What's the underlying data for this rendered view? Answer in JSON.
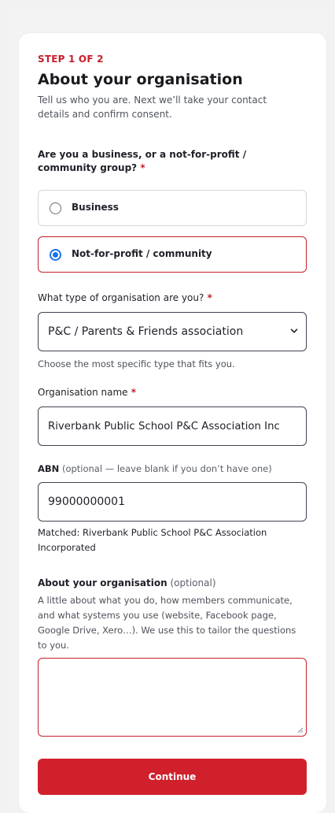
{
  "header": {
    "step": "STEP 1 OF 2",
    "title": "About your organisation",
    "intro": "Tell us who you are. Next we’ll take your contact details and confirm consent."
  },
  "org_kind": {
    "question": "Are you a business, or a not-for-profit / community group?",
    "required_mark": "*",
    "options": [
      {
        "label": "Business",
        "selected": false
      },
      {
        "label": "Not-for-profit / community",
        "selected": true
      }
    ]
  },
  "org_type": {
    "label": "What type of organisation are you?",
    "required_mark": "*",
    "value": "P&C / Parents & Friends association",
    "help": "Choose the most specific type that fits you."
  },
  "org_name": {
    "label": "Organisation name",
    "required_mark": "*",
    "value": "Riverbank Public School P&C Association Inc"
  },
  "abn": {
    "label": "ABN",
    "optional_note": "(optional — leave blank if you don’t have one)",
    "value": "99000000001",
    "match": "Matched: Riverbank Public School P&C Association Incorporated"
  },
  "about": {
    "label": "About your organisation",
    "optional_note": "(optional)",
    "help": "A little about what you do, how members communicate, and what systems you use (website, Facebook page, Google Drive, Xero…). We use this to tailor the questions to you.",
    "value": ""
  },
  "actions": {
    "continue_label": "Continue"
  },
  "colors": {
    "accent": "#c81e2b",
    "radio_selected": "#1a73e8",
    "button": "#d0202c"
  }
}
